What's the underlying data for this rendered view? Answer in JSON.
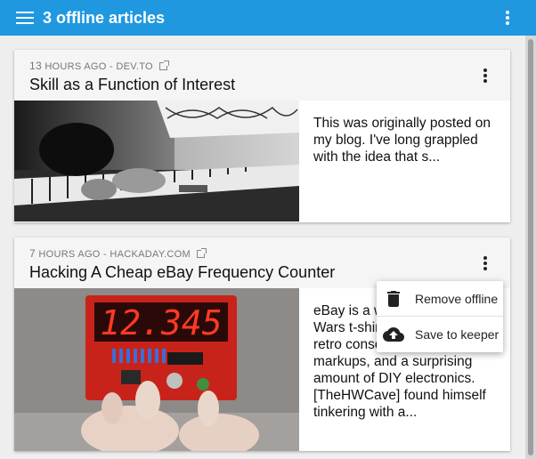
{
  "appbar": {
    "title": "3 offline articles"
  },
  "articles": [
    {
      "time_num": "13",
      "time_unit": "HOURS AGO",
      "source": "DEV.TO",
      "title": "Skill as a Function of Interest",
      "excerpt": "This was originally posted on my blog. I've long grappled with the idea that s..."
    },
    {
      "time_num": "7",
      "time_unit": "HOURS AGO",
      "source": "HACKADAY.COM",
      "title": "Hacking A Cheap eBay Frequency Counter",
      "excerpt": "eBay is a wonderland of Star Wars t-shirts in poor condition, retro consoles at insane markups, and a surprising amount of DIY electronics. [TheHWCave] found himself tinkering with a...",
      "display_value": "12.345"
    }
  ],
  "context_menu": {
    "items": [
      {
        "label": "Remove offline",
        "icon": "trash-icon"
      },
      {
        "label": "Save to keeper",
        "icon": "cloud-upload-icon"
      }
    ]
  },
  "colors": {
    "appbar": "#1f98e0",
    "display_red": "#ff2a1a"
  }
}
